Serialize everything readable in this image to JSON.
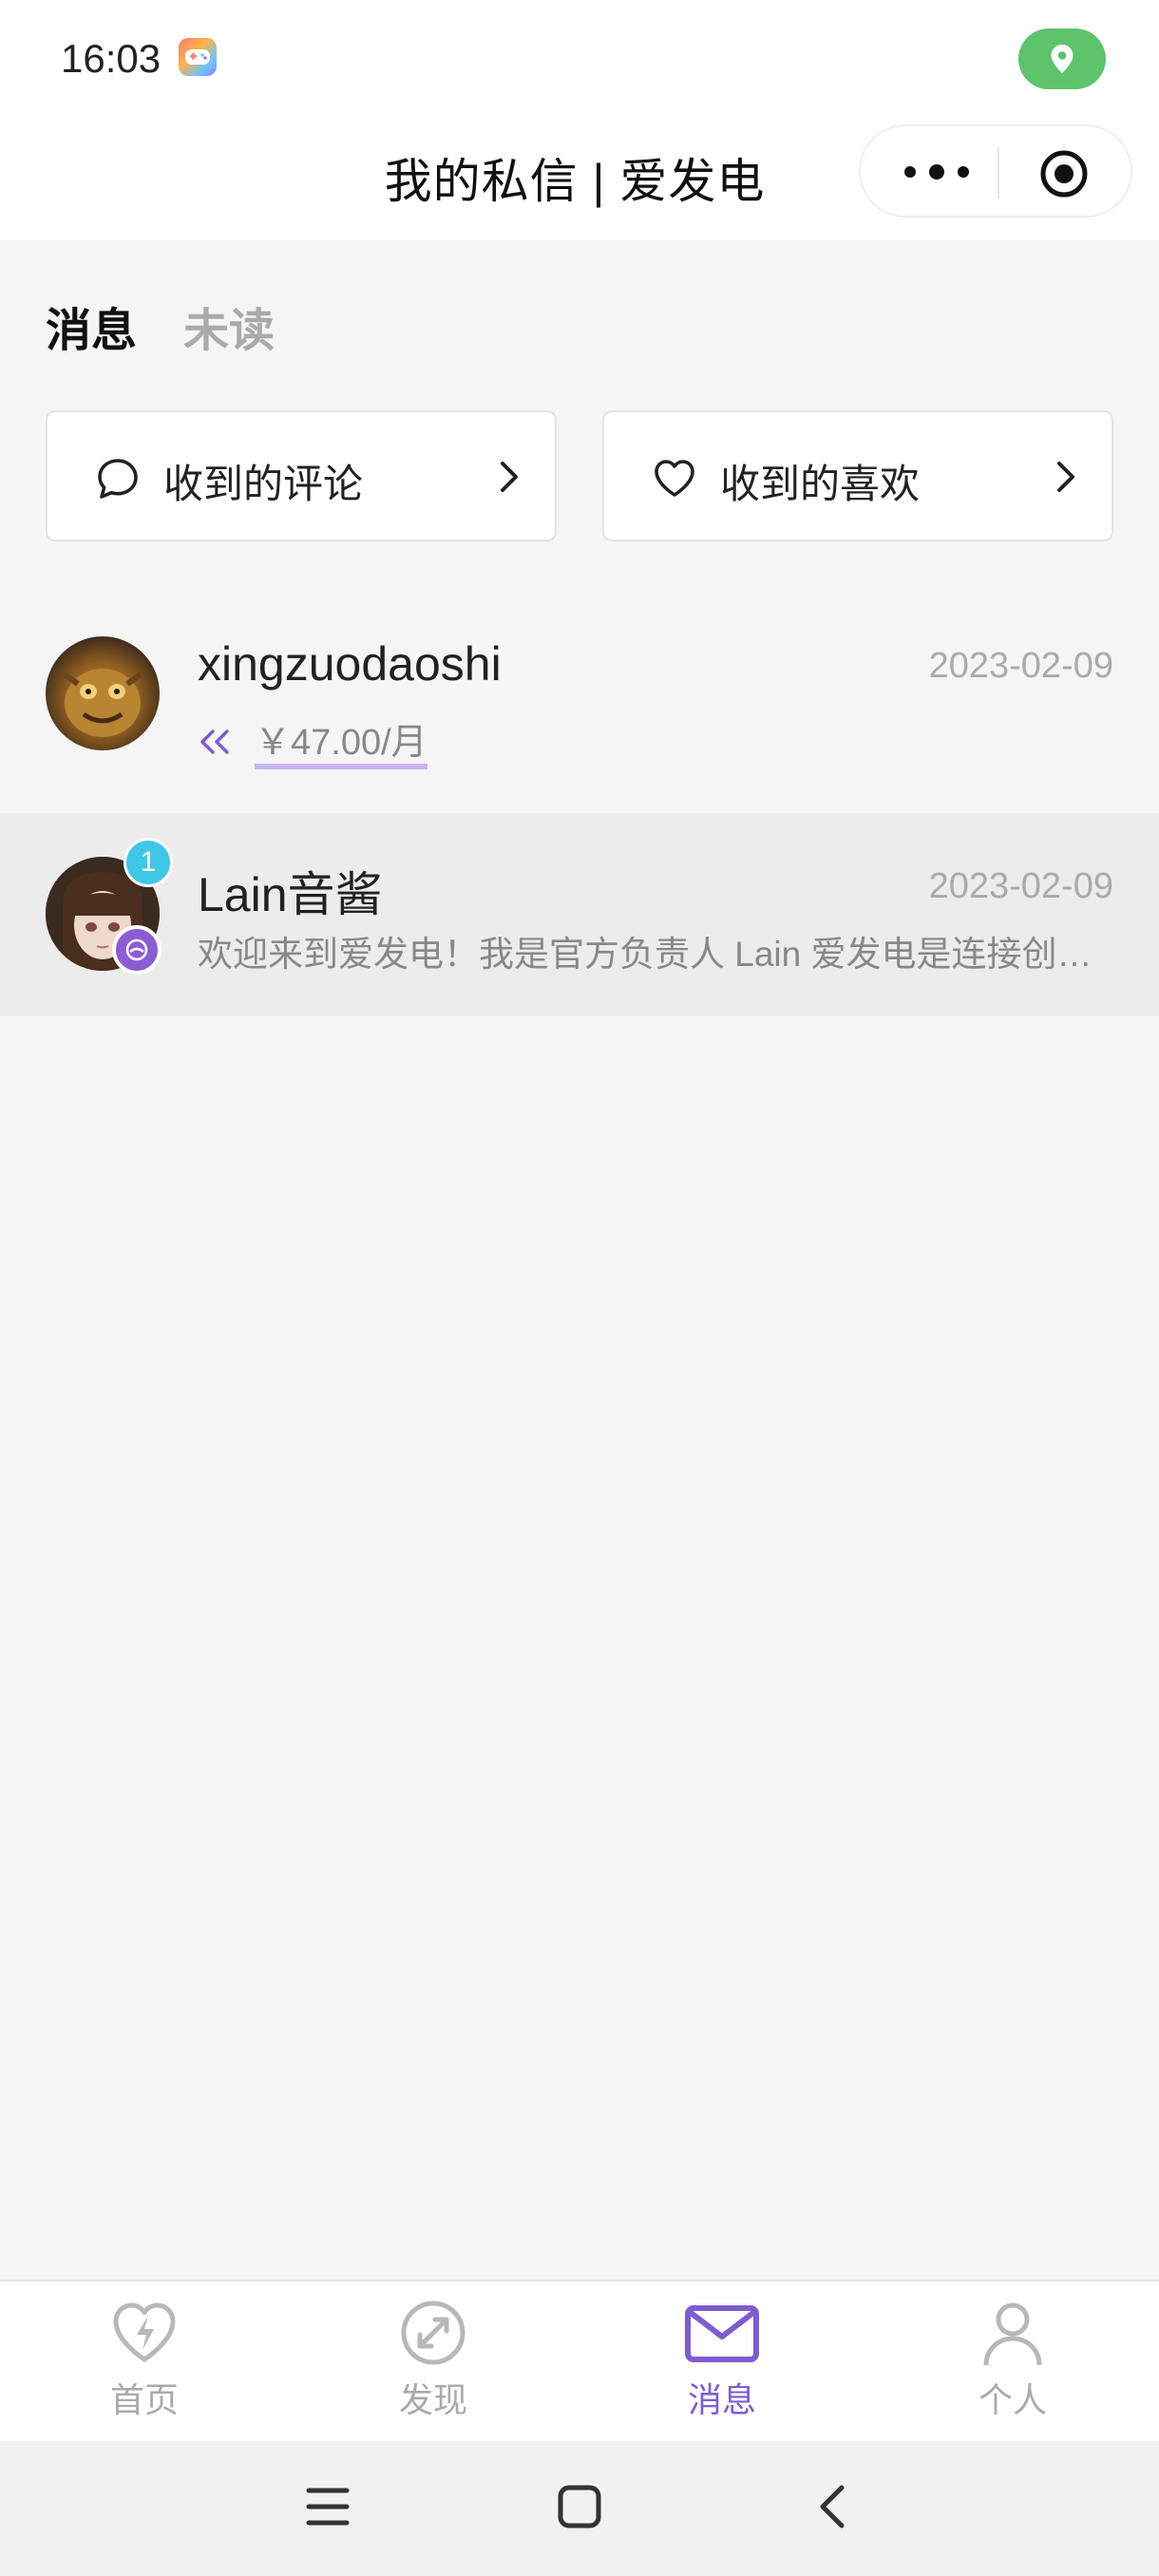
{
  "status_bar": {
    "time": "16:03"
  },
  "nav": {
    "title": "我的私信 | 爱发电"
  },
  "tabs": [
    {
      "label": "消息",
      "active": true
    },
    {
      "label": "未读",
      "active": false
    }
  ],
  "cards": {
    "comments": {
      "label": "收到的评论",
      "icon": "comment-bubble-icon"
    },
    "likes": {
      "label": "收到的喜欢",
      "icon": "heart-outline-icon"
    }
  },
  "messages": [
    {
      "name": "xingzuodaoshi",
      "date": "2023-02-09",
      "sponsor_amount": "￥47.00/月",
      "unread": null
    },
    {
      "name": "Lain音酱",
      "date": "2023-02-09",
      "preview": "欢迎来到爱发电！我是官方负责人 Lain 爱发电是连接创作者与粉丝的平台",
      "unread": "1"
    }
  ],
  "tabbar": [
    {
      "label": "首页",
      "icon": "heart-lightning-icon",
      "active": false
    },
    {
      "label": "发现",
      "icon": "compass-expand-icon",
      "active": false
    },
    {
      "label": "消息",
      "icon": "mail-icon",
      "active": true
    },
    {
      "label": "个人",
      "icon": "person-icon",
      "active": false
    }
  ],
  "colors": {
    "accent": "#7e5cd0",
    "badge": "#3fc7e8",
    "location_pill": "#5dc46b",
    "background": "#f5f5f5"
  }
}
